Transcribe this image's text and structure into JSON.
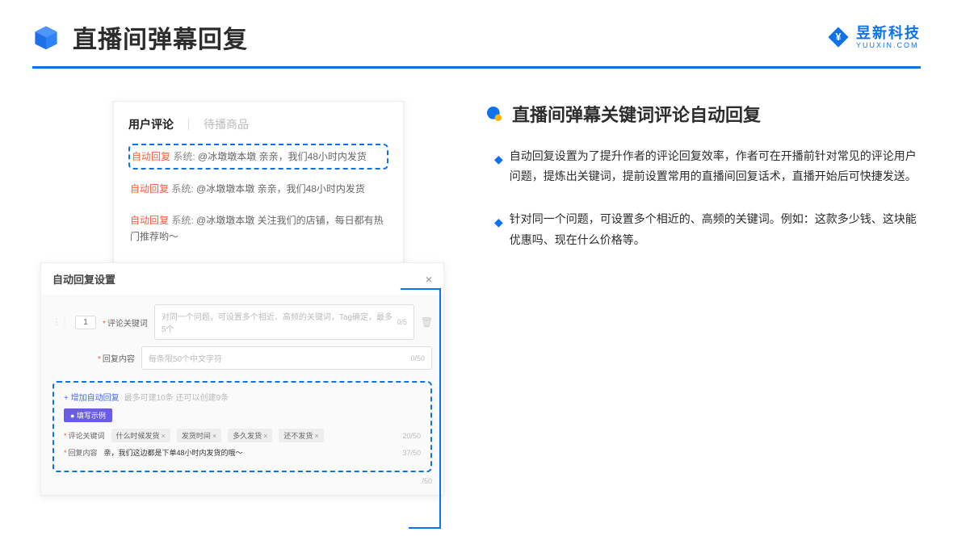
{
  "header": {
    "title": "直播间弹幕回复",
    "brand_cn": "昱新科技",
    "brand_en": "YUUXIN.COM"
  },
  "comments": {
    "tab_active": "用户评论",
    "tab_other": "待播商品",
    "items": [
      {
        "tag": "自动回复",
        "sys": "系统:",
        "text": "@冰墩墩本墩 亲亲，我们48小时内发货"
      },
      {
        "tag": "自动回复",
        "sys": "系统:",
        "text": "@冰墩墩本墩 亲亲，我们48小时内发货"
      },
      {
        "tag": "自动回复",
        "sys": "系统:",
        "text": "@冰墩墩本墩 关注我们的店铺，每日都有热门推荐哟～"
      }
    ]
  },
  "settings": {
    "title": "自动回复设置",
    "num": "1",
    "kw_label": "评论关键词",
    "kw_placeholder": "对同一个问题，可设置多个相近、高频的关键词，Tag确定，最多5个",
    "kw_count": "0/5",
    "content_label": "回复内容",
    "content_placeholder": "每条限50个中文字符",
    "content_count": "0/50",
    "add_label": "+ 增加自动回复",
    "add_hint": "最多可建10条 还可以创建9条",
    "example_badge": "● 填写示例",
    "ex_kw_label": "评论关键词",
    "ex_tags": [
      "什么时候发货",
      "发货时间",
      "多久发货",
      "还不发货"
    ],
    "ex_kw_count": "20/50",
    "ex_content_label": "回复内容",
    "ex_content_value": "亲，我们这边都是下单48小时内发货的哦～",
    "ex_content_count": "37/50",
    "outside_count": "/50"
  },
  "right": {
    "section_title": "直播间弹幕关键词评论自动回复",
    "bullets": [
      "自动回复设置为了提升作者的评论回复效率，作者可在开播前针对常见的评论用户问题，提炼出关键词，提前设置常用的直播间回复话术，直播开始后可快捷发送。",
      "针对同一个问题，可设置多个相近的、高频的关键词。例如：这款多少钱、这块能优惠吗、现在什么价格等。"
    ]
  }
}
